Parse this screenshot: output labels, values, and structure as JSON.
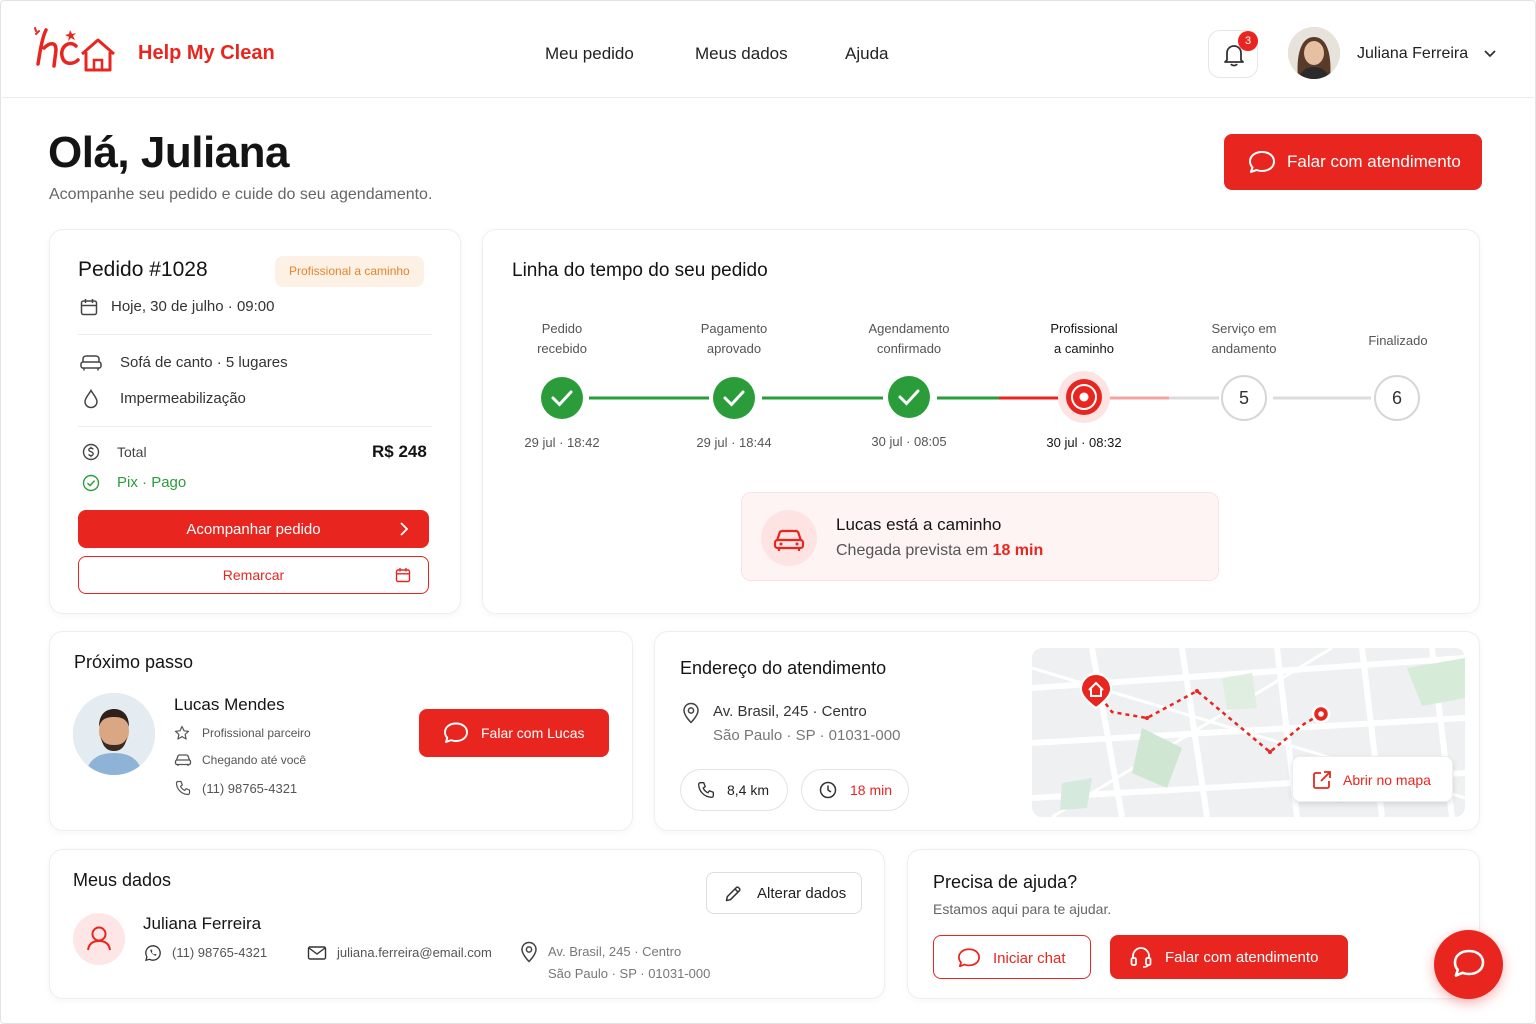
{
  "brand": {
    "name": "Help My Clean",
    "accent": "#e8261f"
  },
  "nav": [
    "Meu pedido",
    "Meus dados",
    "Ajuda"
  ],
  "header": {
    "notification_count": "3",
    "user_name": "Juliana Ferreira"
  },
  "greeting": {
    "title": "Olá, Juliana",
    "subtitle": "Acompanhe seu pedido e cuide do seu agendamento.",
    "cta": "Falar com atendimento"
  },
  "order": {
    "title": "Pedido #1028",
    "badge": "Profissional a caminho",
    "date": "Hoje, 30 de julho",
    "time": "09:00",
    "item": "Sofá de canto",
    "seats": "5 lugares",
    "service": "Impermeabilização",
    "total_label": "Total",
    "total_value": "R$ 248",
    "payment_method": "Pix",
    "payment_status": "Pago",
    "track_label": "Acompanhar pedido",
    "reschedule_label": "Remarcar"
  },
  "timeline": {
    "title": "Linha do tempo do seu pedido",
    "steps": [
      {
        "label1": "Pedido",
        "label2": "recebido",
        "date": "29 jul",
        "time": "18:42",
        "status": "done"
      },
      {
        "label1": "Pagamento",
        "label2": "aprovado",
        "date": "29 jul",
        "time": "18:44",
        "status": "done"
      },
      {
        "label1": "Agendamento",
        "label2": "confirmado",
        "date": "30 jul",
        "time": "08:05",
        "status": "done"
      },
      {
        "label1": "Profissional",
        "label2": "a caminho",
        "date": "30 jul",
        "time": "08:32",
        "status": "current"
      },
      {
        "label1": "Serviço em",
        "label2": "andamento",
        "number": "5",
        "status": "pending"
      },
      {
        "label1": "Finalizado",
        "label2": "",
        "number": "6",
        "status": "pending"
      }
    ],
    "eta_title": "Lucas está a caminho",
    "eta_prefix": "Chegada prevista em",
    "eta_value": "18 min"
  },
  "next_step": {
    "title": "Próximo passo",
    "pro_name": "Lucas Mendes",
    "pro_role": "Profissional parceiro",
    "pro_status": "Chegando até você",
    "pro_phone": "(11) 98765-4321",
    "talk_label": "Falar com Lucas"
  },
  "address": {
    "title": "Endereço do atendimento",
    "street": "Av. Brasil, 245",
    "district": "Centro",
    "city": "São Paulo",
    "state": "SP",
    "zip": "01031-000",
    "distance": "8,4 km",
    "duration": "18 min",
    "open_map": "Abrir no mapa"
  },
  "my_data": {
    "title": "Meus dados",
    "edit_label": "Alterar dados",
    "name": "Juliana Ferreira",
    "phone": "(11) 98765-4321",
    "email": "juliana.ferreira@email.com",
    "address_line1": "Av. Brasil, 245 · Centro",
    "address_line2": "São Paulo · SP · 01031-000"
  },
  "help": {
    "title": "Precisa de ajuda?",
    "subtitle": "Estamos aqui para te ajudar.",
    "chat_label": "Iniciar chat",
    "support_label": "Falar com atendimento"
  }
}
